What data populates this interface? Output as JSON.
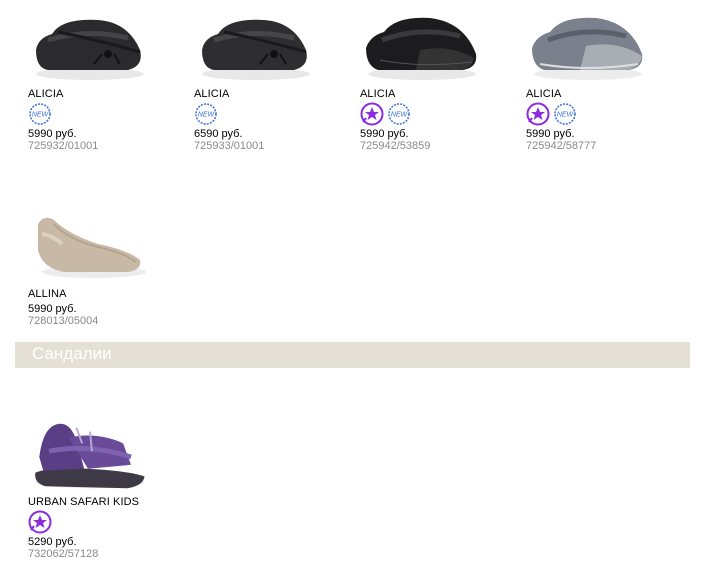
{
  "colors": {
    "badge_star": "#8a2be2",
    "badge_new": "#3a6fd8",
    "section_bg": "#e4e0d6"
  },
  "products": [
    {
      "name": "ALICIA",
      "badges": [
        "new-badge-icon"
      ],
      "price": "5990 руб.",
      "sku": "725932/01001"
    },
    {
      "name": "ALICIA",
      "badges": [
        "new-badge-icon"
      ],
      "price": "6590 руб.",
      "sku": "725933/01001"
    },
    {
      "name": "ALICIA",
      "badges": [
        "star-badge-icon",
        "new-badge-icon"
      ],
      "price": "5990 руб.",
      "sku": "725942/53859"
    },
    {
      "name": "ALICIA",
      "badges": [
        "star-badge-icon",
        "new-badge-icon"
      ],
      "price": "5990 руб.",
      "sku": "725942/58777"
    },
    {
      "name": "ALLINA",
      "badges": [],
      "price": "5990 руб.",
      "sku": "728013/05004"
    }
  ],
  "section": {
    "title": "Сандалии"
  },
  "sandals": [
    {
      "name": "URBAN SAFARI KIDS",
      "badges": [
        "star-badge-icon"
      ],
      "price": "5290 руб.",
      "sku": "732062/57128"
    }
  ],
  "badge_text": {
    "new": "NEW"
  }
}
